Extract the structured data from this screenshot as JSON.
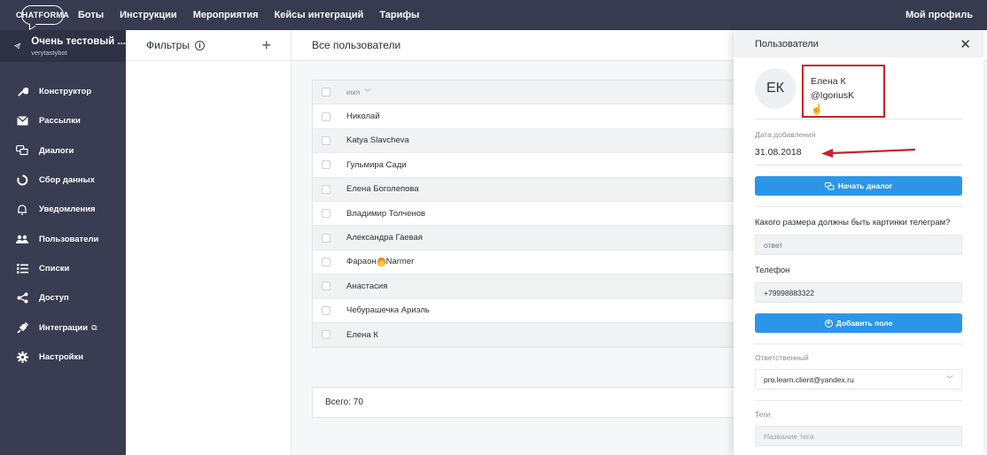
{
  "topbar": {
    "logo": "CHATFORMA",
    "nav": [
      "Боты",
      "Инструкции",
      "Мероприятия",
      "Кейсы интеграций",
      "Тарифы"
    ],
    "profile": "Мой профиль"
  },
  "sidebar": {
    "bot_name": "Очень тестовый ...",
    "bot_handle": "verytastybot",
    "items": [
      {
        "label": "Конструктор",
        "icon": "wrench-icon"
      },
      {
        "label": "Рассылки",
        "icon": "envelope-icon"
      },
      {
        "label": "Диалоги",
        "icon": "chat-bubbles-icon"
      },
      {
        "label": "Сбор данных",
        "icon": "circle-arc-icon"
      },
      {
        "label": "Уведомления",
        "icon": "bell-icon"
      },
      {
        "label": "Пользователи",
        "icon": "users-icon"
      },
      {
        "label": "Списки",
        "icon": "list-icon"
      },
      {
        "label": "Доступ",
        "icon": "share-icon"
      },
      {
        "label": "Интеграции",
        "icon": "plug-icon"
      },
      {
        "label": "Настройки",
        "icon": "gear-icon"
      }
    ]
  },
  "filters": {
    "title": "Фильтры"
  },
  "users": {
    "title": "Все пользователи",
    "column_header": "имя",
    "rows": [
      "Николай",
      "Katya Slavcheva",
      "Гульмира Сади",
      "Елена Боголепова",
      "Владимир Толченов",
      "Александра Гаевая",
      "Фараон",
      "Анастасия",
      "Чебурашечка Ариэль",
      "Елена К"
    ],
    "row7_suffix": "Narmer",
    "total": "Всего: 70"
  },
  "panel": {
    "title": "Пользователи",
    "avatar_initials": "ЕК",
    "user_name": "Елена К",
    "user_handle": "@IgoriusK",
    "date_label": "Дата добавления",
    "date_value": "31.08.2018",
    "start_dialog": "Начать диалог",
    "question_label": "Какого размера должны быть картинки телеграм?",
    "question_answer": "ответ",
    "phone_label": "Телефон",
    "phone_value": "+79998883322",
    "add_field": "Добавить поле",
    "responsible_label": "Ответственный",
    "responsible_value": "pro.learn.client@yandex.ru",
    "tags_label": "Теги",
    "tags_placeholder": "Название тега"
  },
  "colors": {
    "topbar": "#373b4f",
    "sidebar": "#393d51",
    "accent": "#2b96e8",
    "highlight": "#cc1f28"
  }
}
